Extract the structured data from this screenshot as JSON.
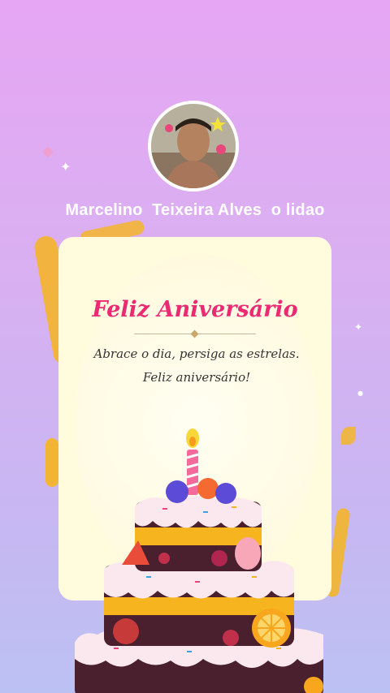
{
  "profile": {
    "username": "Marcelino  Teixeira Alves  o lidao"
  },
  "card": {
    "title": "Feliz Aniversário",
    "message": "Abrace o dia, persiga as estrelas. Feliz aniversário!"
  },
  "colors": {
    "background_top": "#e6a6f3",
    "background_bottom": "#bcc1f3",
    "title": "#ea2a72",
    "card": "#fffbdc",
    "ribbon": "#f6b51e"
  },
  "icons": [
    "sparkle-icon",
    "birthday-cake-icon",
    "candle-icon"
  ]
}
